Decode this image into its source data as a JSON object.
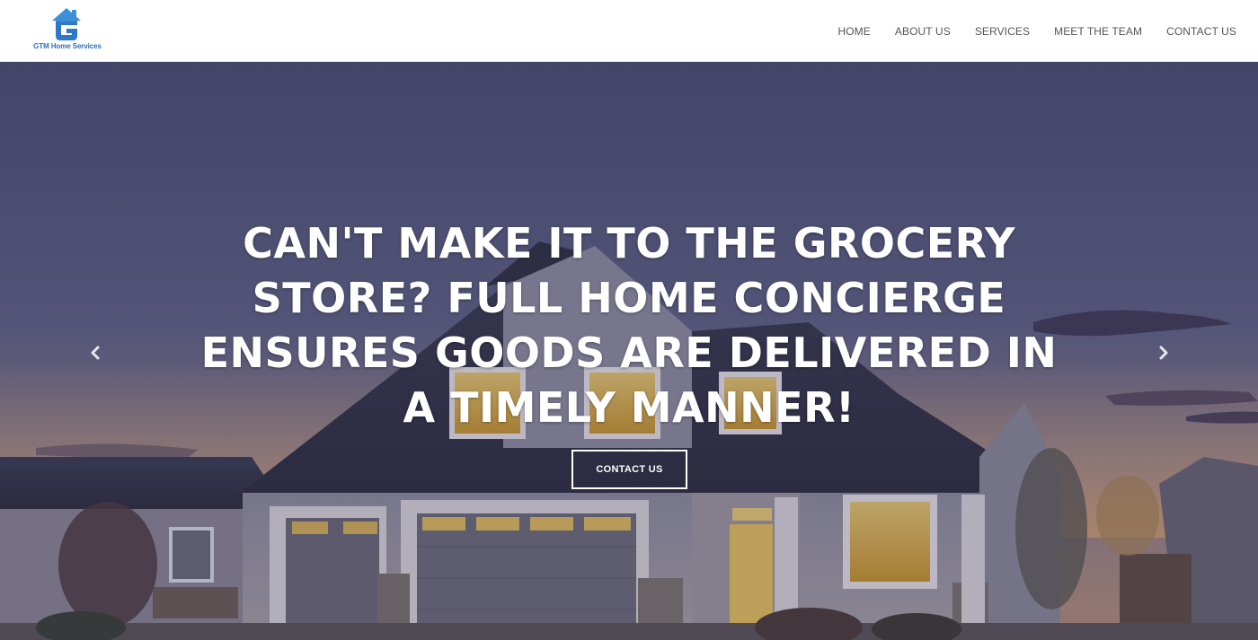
{
  "brand": {
    "name": "GTM Home Services",
    "logo_icon": "house-g-logo-icon",
    "color": "#2f6fb6"
  },
  "nav": {
    "items": [
      {
        "label": "HOME"
      },
      {
        "label": "ABOUT US"
      },
      {
        "label": "SERVICES"
      },
      {
        "label": "MEET THE TEAM"
      },
      {
        "label": "CONTACT US"
      }
    ]
  },
  "hero": {
    "headline": "CAN'T MAKE IT TO THE GROCERY STORE? FULL HOME CONCIERGE ENSURES GOODS ARE DELIVERED IN A TIMELY MANNER!",
    "cta_label": "CONTACT US",
    "prev_icon": "chevron-left-icon",
    "next_icon": "chevron-right-icon"
  }
}
